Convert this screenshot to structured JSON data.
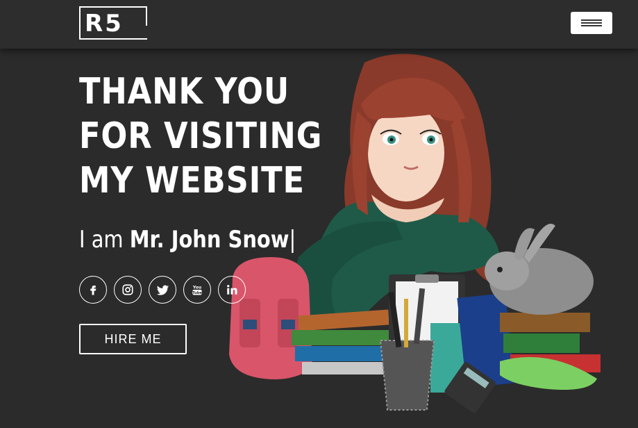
{
  "header": {
    "logo_text": "R5",
    "menu_icon": "hamburger-icon"
  },
  "hero": {
    "headline": "THANK YOU FOR VISITING MY WEBSITE",
    "intro_prefix": "I am",
    "name": "Mr. John Snow",
    "cursor": "|",
    "hire_label": "HIRE ME",
    "illustration": "girl-with-school-supplies-illustration"
  },
  "socials": [
    {
      "icon": "facebook-icon"
    },
    {
      "icon": "instagram-icon"
    },
    {
      "icon": "twitter-icon"
    },
    {
      "icon": "youtube-icon",
      "label": "You Tube"
    },
    {
      "icon": "linkedin-icon",
      "label": "in"
    }
  ],
  "colors": {
    "background": "#2b2b2b",
    "navbar": "#2d2d2d",
    "text": "#ffffff"
  }
}
